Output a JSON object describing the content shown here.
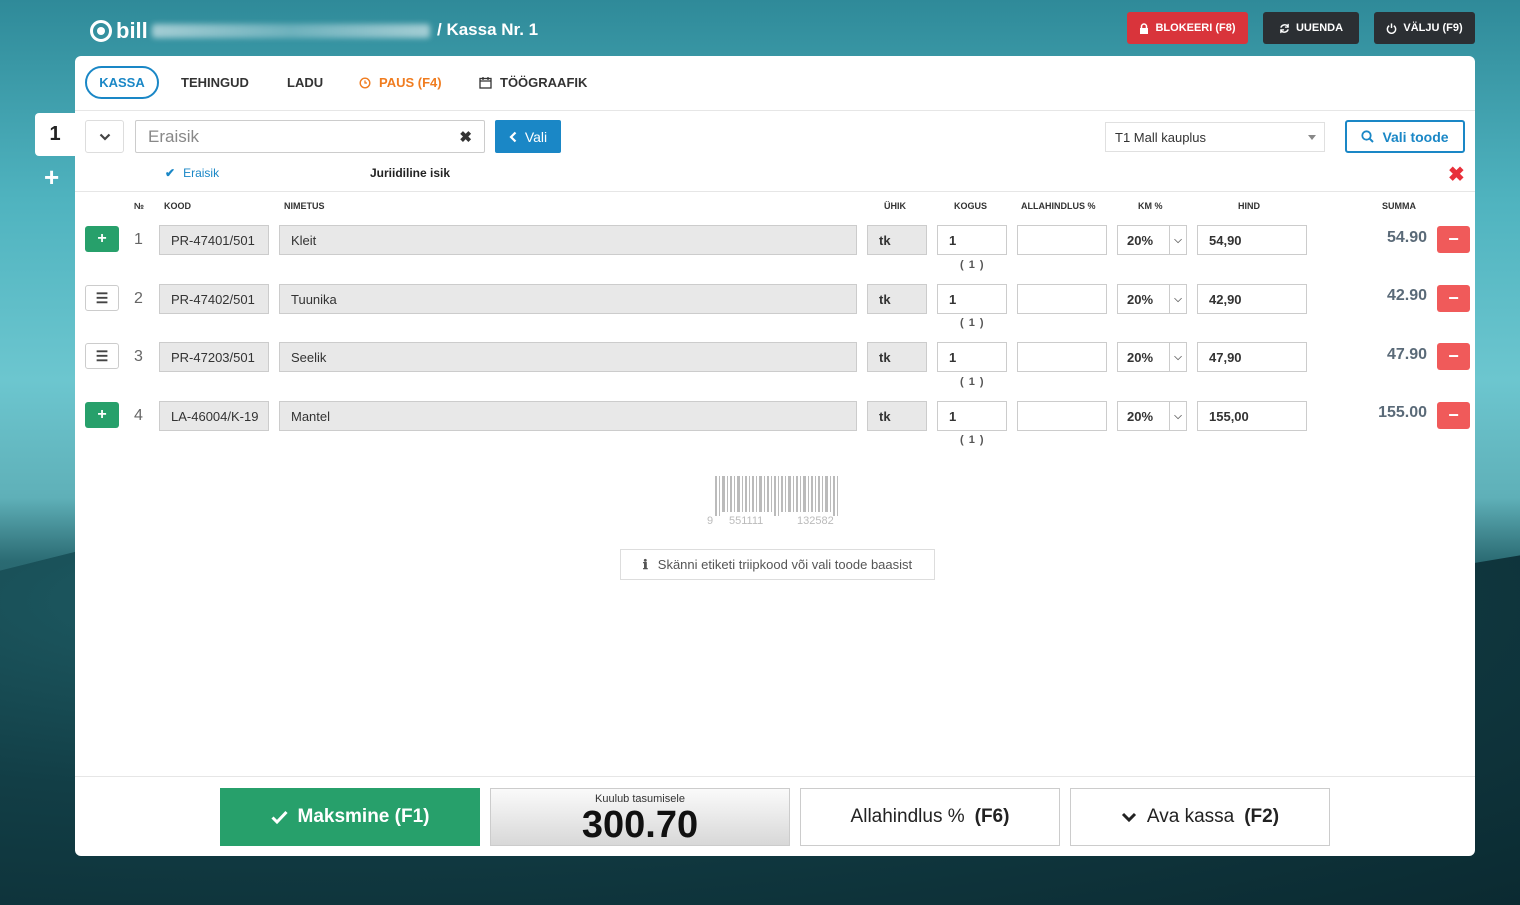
{
  "app": {
    "logo_text": "bill",
    "title": "/ Kassa Nr. 1"
  },
  "top_buttons": {
    "block": "BLOKEERI (F8)",
    "refresh": "UUENDA",
    "exit": "VÄLJU (F9)"
  },
  "tabs": [
    {
      "label": "KASSA"
    },
    {
      "label": "TEHINGUD"
    },
    {
      "label": "LADU"
    },
    {
      "label": "PAUS (F4)"
    },
    {
      "label": "TÖÖGRAAFIK"
    }
  ],
  "side": {
    "sale_number": "1",
    "add": "+"
  },
  "customer": {
    "placeholder": "Eraisik",
    "select_button": "Vali",
    "type_private": "Eraisik",
    "type_legal": "Juriidiline isik"
  },
  "store": {
    "selected": "T1 Mall kauplus"
  },
  "select_product_button": "Vali toode",
  "columns": {
    "no": "№",
    "code": "KOOD",
    "name": "NIMETUS",
    "unit": "ÜHIK",
    "qty": "KOGUS",
    "discount": "ALLAHINDLUS %",
    "vat": "KM %",
    "price": "HIND",
    "sum": "SUMMA"
  },
  "rows": [
    {
      "no": "1",
      "code": "PR-47401/501",
      "name": "Kleit",
      "unit": "tk",
      "qty": "1",
      "qty_sub": "( 1 )",
      "discount": "",
      "vat": "20%",
      "price": "54,90",
      "sum": "54.90",
      "action": "plus"
    },
    {
      "no": "2",
      "code": "PR-47402/501",
      "name": "Tuunika",
      "unit": "tk",
      "qty": "1",
      "qty_sub": "( 1 )",
      "discount": "",
      "vat": "20%",
      "price": "42,90",
      "sum": "42.90",
      "action": "menu"
    },
    {
      "no": "3",
      "code": "PR-47203/501",
      "name": "Seelik",
      "unit": "tk",
      "qty": "1",
      "qty_sub": "( 1 )",
      "discount": "",
      "vat": "20%",
      "price": "47,90",
      "sum": "47.90",
      "action": "menu"
    },
    {
      "no": "4",
      "code": "LA-46004/K-19",
      "name": "Mantel",
      "unit": "tk",
      "qty": "1",
      "qty_sub": "( 1 )",
      "discount": "",
      "vat": "20%",
      "price": "155,00",
      "sum": "155.00",
      "action": "plus"
    }
  ],
  "barcode": {
    "left_digit": "9",
    "mid_digits": "551111",
    "right_digits": "132582"
  },
  "hint": "Skänni etiketi triipkood või vali toode baasist",
  "footer": {
    "pay": "Maksmine (F1)",
    "total_label": "Kuulub tasumisele",
    "total_value": "300.70",
    "discount_prefix": "Allahindlus %",
    "discount_key": "(F6)",
    "drawer_prefix": "Ava kassa",
    "drawer_key": "(F2)"
  },
  "colors": {
    "accent": "#1a87c6",
    "success": "#27a06b",
    "danger": "#f05a5a",
    "pause": "#f07c1f"
  }
}
